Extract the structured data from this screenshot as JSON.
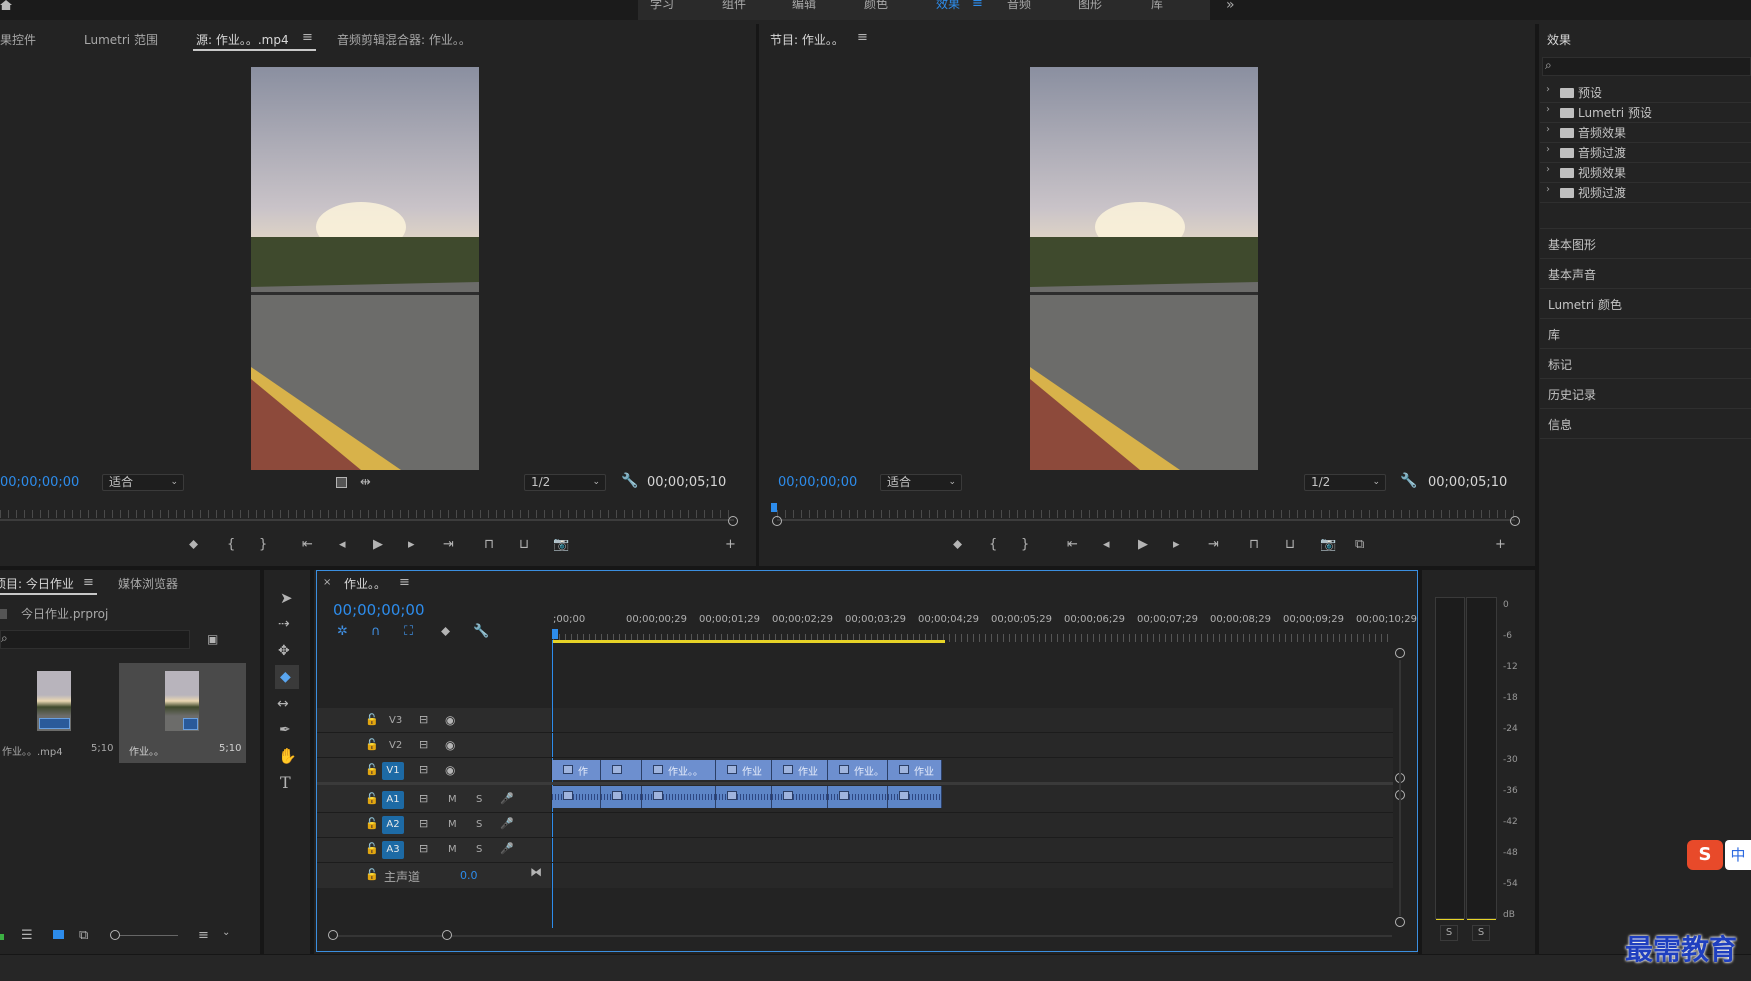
{
  "workspace": {
    "tabs": [
      "学习",
      "组件",
      "编辑",
      "颜色",
      "效果",
      "音频",
      "图形",
      "库"
    ],
    "active_tab": "效果",
    "more_glyph": "»"
  },
  "source_panel": {
    "tabs": [
      "效果控件",
      "Lumetri 范围",
      "源: 作业。。.mp4",
      "音频剪辑混合器: 作业。。"
    ],
    "active_tab": "源: 作业。。.mp4",
    "timecode_left": "00;00;00;00",
    "fit_label": "适合",
    "quality": "1/2",
    "timecode_right": "00;00;05;10"
  },
  "program_panel": {
    "title": "节目: 作业。。",
    "timecode_left": "00;00;00;00",
    "fit_label": "适合",
    "quality": "1/2",
    "timecode_right": "00;00;05;10"
  },
  "effects_panel": {
    "title": "效果",
    "search_placeholder": "",
    "folders": [
      "预设",
      "Lumetri 预设",
      "音频效果",
      "音频过渡",
      "视频效果",
      "视频过渡"
    ],
    "sections": [
      "基本图形",
      "基本声音",
      "Lumetri 颜色",
      "库",
      "标记",
      "历史记录",
      "信息"
    ]
  },
  "project_panel": {
    "tabs": [
      "项目: 今日作业",
      "媒体浏览器"
    ],
    "file_name": "今日作业.prproj",
    "items": [
      {
        "name": "作业。。.mp4",
        "duration": "5;10"
      },
      {
        "name": "作业。。",
        "duration": "5;10"
      }
    ]
  },
  "timeline": {
    "sequence_name": "作业。。",
    "timecode": "00;00;00;00",
    "ruler": [
      ";00;00",
      "00;00;00;29",
      "00;00;01;29",
      "00;00;02;29",
      "00;00;03;29",
      "00;00;04;29",
      "00;00;05;29",
      "00;00;06;29",
      "00;00;07;29",
      "00;00;08;29",
      "00;00;09;29",
      "00;00;10;29"
    ],
    "video_tracks": [
      "V3",
      "V2",
      "V1"
    ],
    "audio_tracks": [
      "A1",
      "A2",
      "A3"
    ],
    "mute_label": "M",
    "solo_label": "S",
    "master_label": "主声道",
    "master_value": "0.0",
    "video_clips": [
      "作",
      "",
      "作业。。",
      "作业",
      "作业",
      "作业。",
      "作业"
    ],
    "audio_clips": [
      "",
      "",
      "",
      "",
      "",
      "",
      ""
    ]
  },
  "audio_meter": {
    "scale": [
      "0",
      "-6",
      "-12",
      "-18",
      "-24",
      "-30",
      "-36",
      "-42",
      "-48",
      "-54",
      "dB"
    ],
    "solo_labels": [
      "S",
      "S"
    ]
  },
  "watermark": {
    "text": "最需教育",
    "ime_label": "中"
  },
  "colors": {
    "accent_blue": "#2d8ceb",
    "track_blue": "#1d6aa5",
    "clip_video": "#6d8fcf",
    "clip_audio": "#5d85c6",
    "work_area": "#e6d327",
    "panel_bg": "#232323"
  }
}
